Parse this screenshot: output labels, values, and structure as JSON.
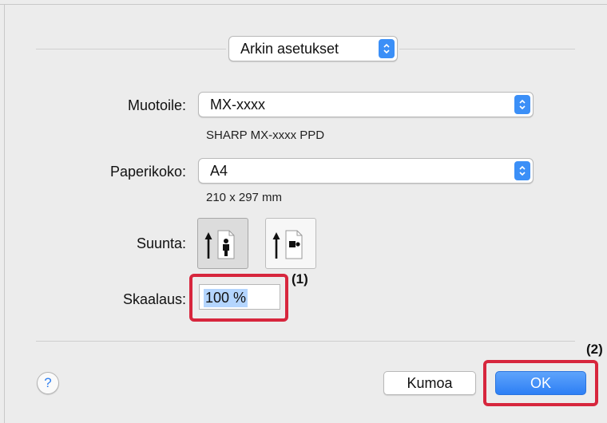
{
  "section_popup": {
    "value": "Arkin asetukset"
  },
  "format": {
    "label": "Muotoile:",
    "value": "MX-xxxx",
    "description": "SHARP MX-xxxx PPD"
  },
  "paper_size": {
    "label": "Paperikoko:",
    "value": "A4",
    "dimensions": "210 x 297 mm"
  },
  "orientation": {
    "label": "Suunta:",
    "selected": "portrait"
  },
  "scale": {
    "label": "Skaalaus:",
    "value": "100 %"
  },
  "callouts": {
    "first": "(1)",
    "second": "(2)"
  },
  "buttons": {
    "help": "?",
    "cancel": "Kumoa",
    "ok": "OK"
  },
  "colors": {
    "accent": "#3b8ff7",
    "highlight_border": "#d7263d",
    "selection": "#b4d5fe"
  }
}
